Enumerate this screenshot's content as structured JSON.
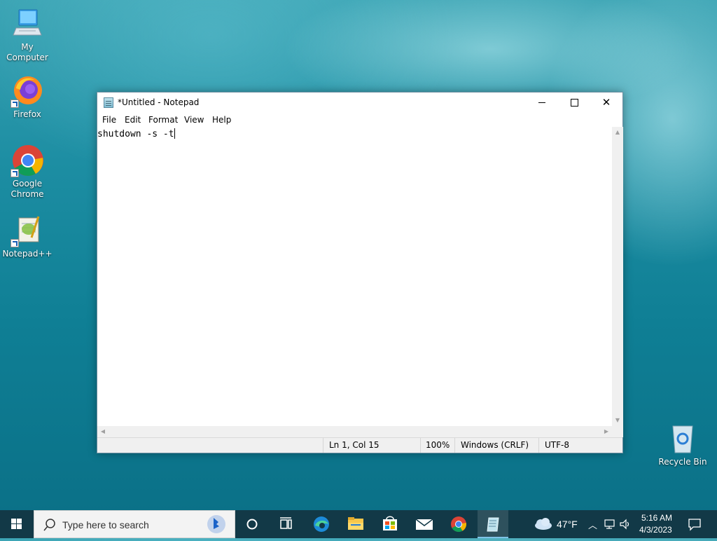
{
  "desktop": {
    "icons": [
      {
        "label": "My Computer"
      },
      {
        "label": "Firefox"
      },
      {
        "label": "Google Chrome"
      },
      {
        "label": "Notepad++"
      },
      {
        "label": "Recycle Bin"
      }
    ]
  },
  "notepad": {
    "title": "*Untitled - Notepad",
    "menu": [
      "File",
      "Edit",
      "Format",
      "View",
      "Help"
    ],
    "content": "shutdown -s -t",
    "status": {
      "position": "Ln 1, Col 15",
      "zoom": "100%",
      "line_ending": "Windows (CRLF)",
      "encoding": "UTF-8"
    }
  },
  "taskbar": {
    "search_placeholder": "Type here to search",
    "weather": "47°F",
    "time": "5:16 AM",
    "date": "4/3/2023"
  },
  "colors": {
    "taskbar": "#123947",
    "accent": "#0078d7"
  }
}
